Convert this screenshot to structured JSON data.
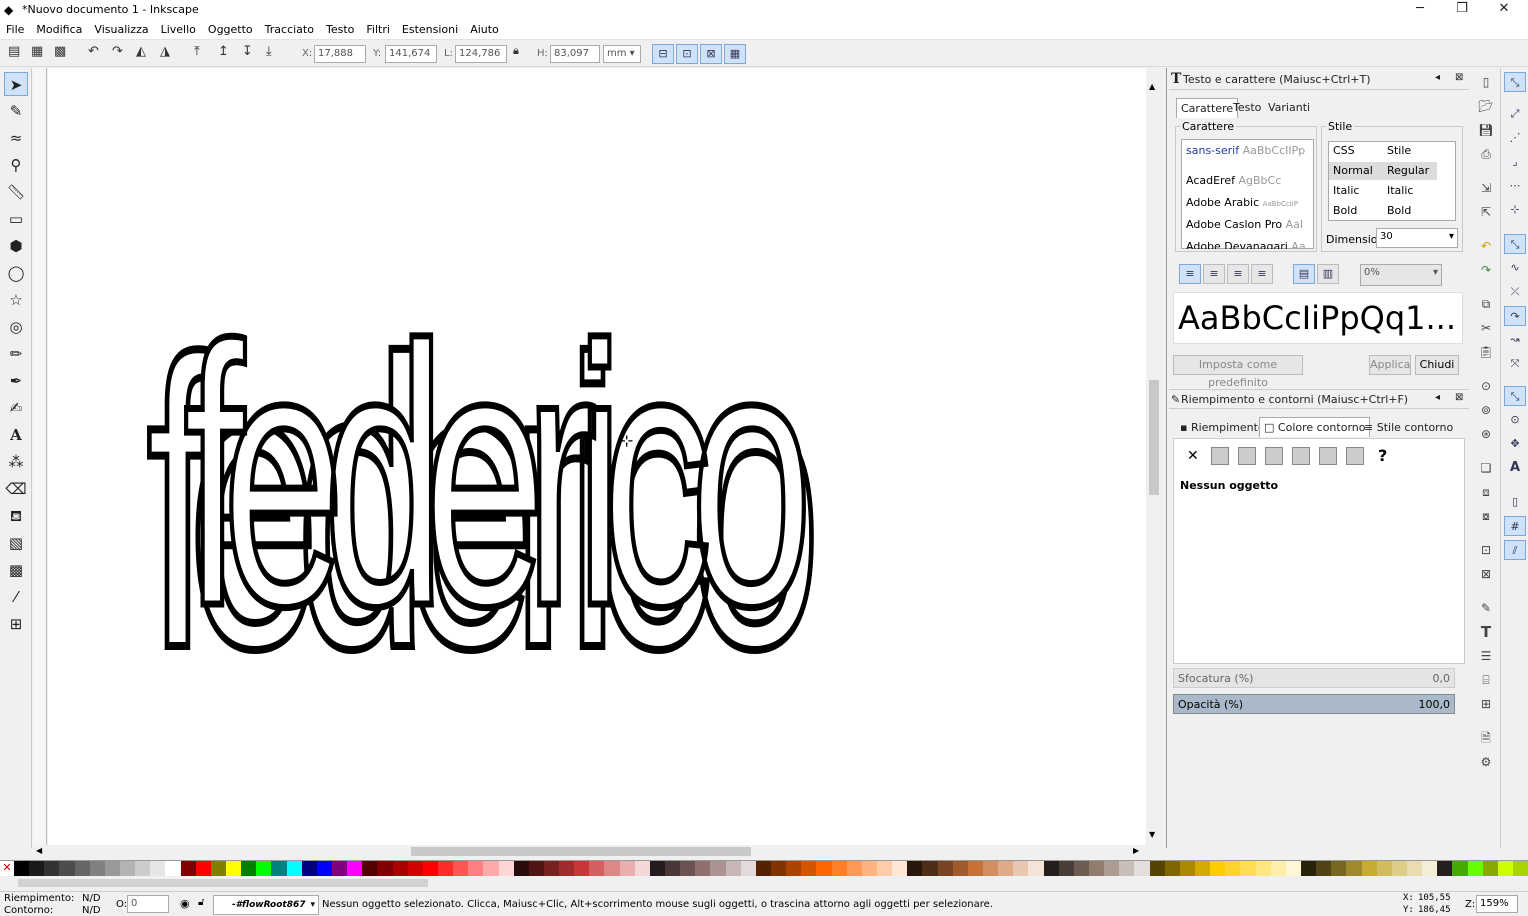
{
  "window": {
    "title": "*Nuovo documento 1 - Inkscape",
    "minimize": "─",
    "restore": "❐",
    "close": "✕"
  },
  "menu": [
    "File",
    "Modifica",
    "Visualizza",
    "Livello",
    "Oggetto",
    "Tracciato",
    "Testo",
    "Filtri",
    "Estensioni",
    "Aiuto"
  ],
  "controls": {
    "x_label": "X:",
    "x_value": "17,888",
    "y_label": "Y:",
    "y_value": "141,674",
    "w_label": "L:",
    "w_value": "124,786",
    "h_label": "H:",
    "h_value": "83,097",
    "unit": "mm"
  },
  "canvas": {
    "text": "federico"
  },
  "text_dialog": {
    "title": "Testo e carattere (Maiusc+Ctrl+T)",
    "tabs": [
      "Carattere",
      "Testo",
      "Varianti"
    ],
    "font_frame": "Carattere",
    "fonts": [
      {
        "name": "sans-serif",
        "preview": "AaBbCcIIPp"
      },
      {
        "name": "AcadEref",
        "preview": "AgBbCc"
      },
      {
        "name": "Adobe Arabic",
        "preview": "AaBbCcIiP"
      },
      {
        "name": "Adobe Caslon Pro",
        "preview": "AaI"
      },
      {
        "name": "Adobe Devanagari",
        "preview": "Aa"
      }
    ],
    "style_frame": "Stile",
    "style_header": [
      "CSS",
      "Stile"
    ],
    "styles": [
      [
        "Normal",
        "Regular"
      ],
      [
        "Italic",
        "Italic"
      ],
      [
        "Bold",
        "Bold"
      ]
    ],
    "size_label": "Dimensione",
    "size_value": "30",
    "spacing_value": "0%",
    "preview": "AaBbCcIiPpQq1...",
    "set_default": "Imposta come predefinito",
    "apply": "Applica",
    "close": "Chiudi"
  },
  "fill_dialog": {
    "title": "Riempimento e contorni (Maiusc+Ctrl+F)",
    "tabs": [
      "Riempimento",
      "Colore contorno",
      "Stile contorno"
    ],
    "no_object": "Nessun oggetto",
    "unknown": "?",
    "none_symbol": "✕",
    "blur_label": "Sfocatura (%)",
    "blur_value": "0,0",
    "opacity_label": "Opacità (%)",
    "opacity_value": "100,0"
  },
  "status": {
    "fill_label": "Riempimento:",
    "fill_value": "N/D",
    "stroke_label": "Contorno:",
    "stroke_value": "N/D",
    "opacity_label": "O:",
    "opacity_value": "0",
    "layer": "-#flowRoot867",
    "message": "Nessun oggetto selezionato. Clicca, Maiusc+Clic, Alt+scorrimento mouse sugli oggetti, o trascina attorno agli oggetti per selezionare.",
    "x_label": "X:",
    "x_value": "105,55",
    "y_label": "Y:",
    "y_value": "186,45",
    "zoom_label": "Z:",
    "zoom_value": "159%"
  },
  "palette": [
    "#000000",
    "#1a1a1a",
    "#333333",
    "#4d4d4d",
    "#666666",
    "#808080",
    "#999999",
    "#b3b3b3",
    "#cccccc",
    "#e6e6e6",
    "#ffffff",
    "#800000",
    "#ff0000",
    "#808000",
    "#ffff00",
    "#008000",
    "#00ff00",
    "#008080",
    "#00ffff",
    "#000080",
    "#0000ff",
    "#800080",
    "#ff00ff",
    "#550000",
    "#800000",
    "#aa0000",
    "#d40000",
    "#ff0000",
    "#ff2a2a",
    "#ff5555",
    "#ff8080",
    "#ffaaaa",
    "#ffd5d5",
    "#280b0b",
    "#501616",
    "#782121",
    "#a02c2c",
    "#c83737",
    "#d35f5f",
    "#de8787",
    "#e9afaf",
    "#f4d7d7",
    "#241c1c",
    "#483737",
    "#6c5353",
    "#916f6f",
    "#ac9393",
    "#c8b7b7",
    "#e3dbdb",
    "#552200",
    "#803300",
    "#aa4400",
    "#d45500",
    "#ff6600",
    "#ff7f2a",
    "#ff9955",
    "#ffb380",
    "#ffccaa",
    "#ffe6d5",
    "#28170b",
    "#502d16",
    "#784421",
    "#a05a2c",
    "#c87137",
    "#d38d5f",
    "#deaa87",
    "#e9c6af",
    "#f4e3d7",
    "#241f1c",
    "#483e37",
    "#6c5d53",
    "#917c6f",
    "#ac9d93",
    "#c8beb7",
    "#e3dedb",
    "#554400",
    "#806600",
    "#aa8800",
    "#d4aa00",
    "#ffcc00",
    "#ffd42a",
    "#ffdd55",
    "#ffe680",
    "#ffeeaa",
    "#fff6d5",
    "#28220b",
    "#504416",
    "#786721",
    "#a0892c",
    "#c8ab37",
    "#d3bc5f",
    "#decd87",
    "#e9ddaf",
    "#f4eed7",
    "#241f1c",
    "#44aa00",
    "#66ff00",
    "#88aa00",
    "#ccff00",
    "#aad400"
  ]
}
